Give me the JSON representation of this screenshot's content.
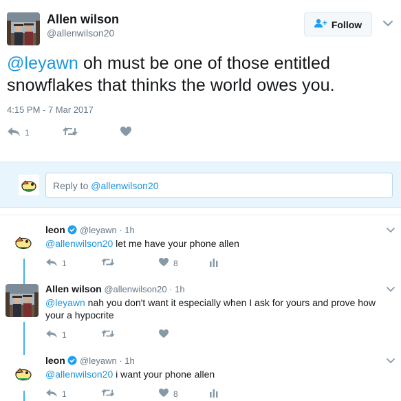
{
  "tweet": {
    "author_name": "Allen wilson",
    "author_handle": "@allenwilson20",
    "follow_label": "Follow",
    "text_mention": "@leyawn",
    "text_body": " oh must be one of those entitled snowflakes that thinks the world owes you.",
    "timestamp": "4:15 PM - 7 Mar 2017",
    "reply_count": "1"
  },
  "reply_box": {
    "prefix": "Reply to ",
    "mention": "@allenwilson20"
  },
  "replies": [
    {
      "name": "leon",
      "handle": "@leyawn",
      "time": "1h",
      "mention": "@allenwilson20",
      "text": " let me have your phone allen",
      "reply_count": "1",
      "like_count": "8",
      "verified": true
    },
    {
      "name": "Allen wilson",
      "handle": "@allenwilson20",
      "time": "1h",
      "mention": "@leyawn",
      "text": " nah you don't want it especially when I ask for yours and prove how your a hypocrite",
      "reply_count": "1",
      "like_count": "",
      "verified": false
    },
    {
      "name": "leon",
      "handle": "@leyawn",
      "time": "1h",
      "mention": "@allenwilson20",
      "text": " i want your phone allen",
      "reply_count": "1",
      "like_count": "8",
      "verified": true
    }
  ],
  "icons": {
    "reply": "reply-icon",
    "retweet": "retweet-icon",
    "like": "heart-icon",
    "analytics": "analytics-icon",
    "follow": "add-user-icon",
    "more": "chevron-down-icon",
    "verified": "verified-badge-icon"
  },
  "colors": {
    "link": "#1b95e0",
    "muted": "#657786",
    "thread_line": "#1da1f2",
    "reply_bar_bg": "#e8f5fd",
    "verified": "#1da1f2"
  },
  "separator": " · "
}
